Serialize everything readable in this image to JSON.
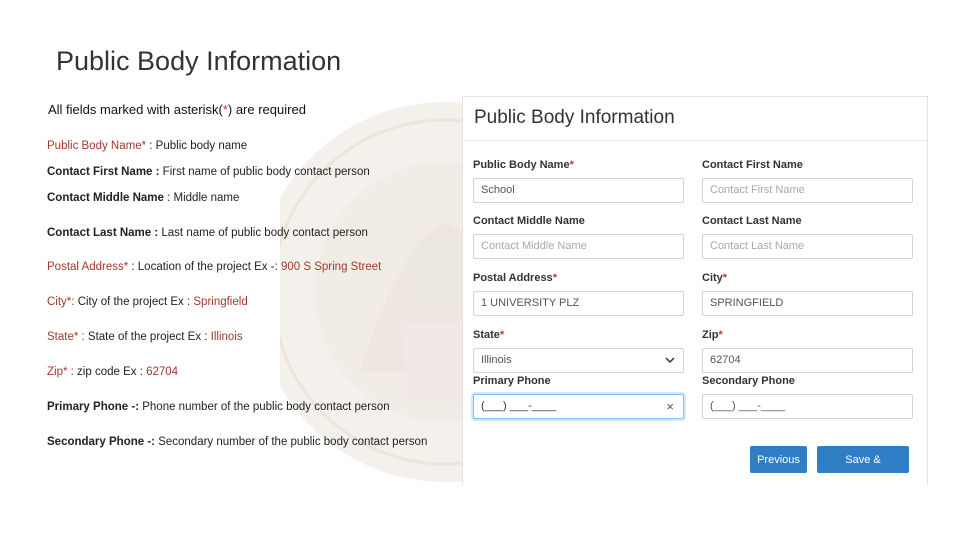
{
  "slide_title": "Public Body Information",
  "required_note": {
    "before": "All fields marked with asterisk(",
    "star": "*",
    "after": ") are required"
  },
  "descriptions": [
    {
      "label": "Public Body Name*",
      "sep": " :  ",
      "text": "Public body name",
      "example": ""
    },
    {
      "label": "Contact First Name :",
      "sep": " ",
      "text": "First name of public body contact person",
      "example": ""
    },
    {
      "label": "Contact Middle Name",
      "sep": " :  ",
      "text": "Middle name",
      "example": ""
    },
    {
      "label": "Contact Last Name :",
      "sep": " ",
      "text": "Last name of public body contact person",
      "example": ""
    },
    {
      "label": "Postal Address*",
      "sep": " : ",
      "text": "Location of the project Ex -: ",
      "example": "900 S Spring Street"
    },
    {
      "label": "City*:",
      "sep": "  ",
      "text": "City of the project Ex : ",
      "example": "Springfield"
    },
    {
      "label": "State* :",
      "sep": "  ",
      "text": "State of the project Ex : ",
      "example": "Illinois"
    },
    {
      "label": "Zip* :",
      "sep": "  ",
      "text": "zip code Ex : ",
      "example": "62704"
    },
    {
      "label": "Primary Phone -:",
      "sep": " ",
      "text": "Phone number of the public body contact person",
      "example": ""
    },
    {
      "label": "Secondary Phone -:",
      "sep": " ",
      "text": "Secondary number of the public body contact person",
      "example": ""
    }
  ],
  "form": {
    "title": "Public Body Information",
    "fields": {
      "public_body_name": {
        "label": "Public Body Name",
        "req": "*",
        "value": "School"
      },
      "contact_first_name": {
        "label": "Contact First Name",
        "req": "",
        "placeholder": "Contact First Name"
      },
      "contact_middle_name": {
        "label": "Contact Middle Name",
        "req": "",
        "placeholder": "Contact Middle Name"
      },
      "contact_last_name": {
        "label": "Contact Last Name",
        "req": "",
        "placeholder": "Contact Last Name"
      },
      "postal_address": {
        "label": "Postal Address",
        "req": "*",
        "value": "1 UNIVERSITY PLZ"
      },
      "city": {
        "label": "City",
        "req": "*",
        "value": "SPRINGFIELD"
      },
      "state": {
        "label": "State",
        "req": "*",
        "value": "Illinois"
      },
      "zip": {
        "label": "Zip",
        "req": "*",
        "value": "62704"
      },
      "primary_phone": {
        "label": "Primary Phone",
        "req": "",
        "value": "(___) ___-____"
      },
      "secondary_phone": {
        "label": "Secondary Phone",
        "req": "",
        "value": "(___) ___-____"
      }
    },
    "buttons": {
      "previous": "Previous",
      "save_continue": "Save & Continue"
    }
  },
  "colors": {
    "accent_red": "#a0392c",
    "button_blue": "#2f7ec6",
    "focus_blue": "#80bdff"
  },
  "icons": {
    "state_dropdown": "chevron-down-icon",
    "phone_clear": "close-icon"
  }
}
